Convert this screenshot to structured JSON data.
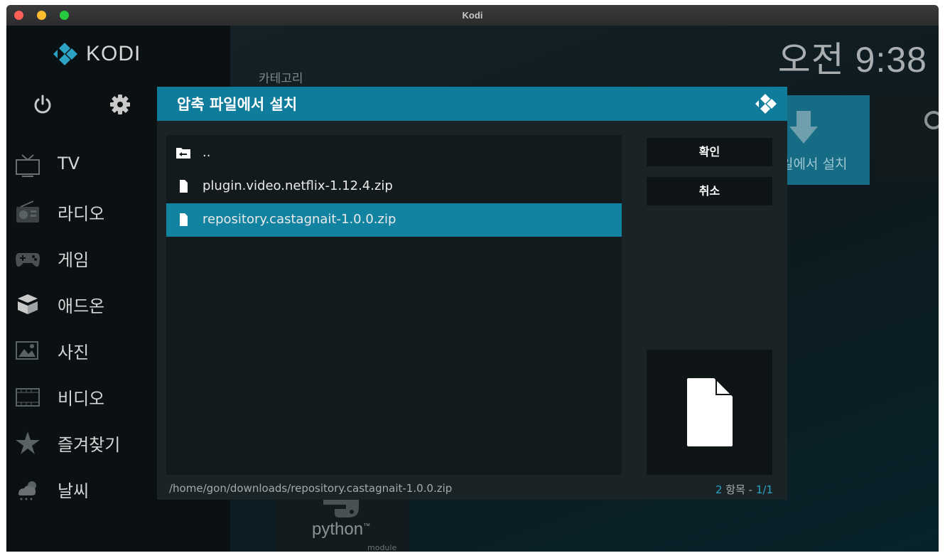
{
  "window": {
    "title": "Kodi"
  },
  "header": {
    "clock": "오전 9:38",
    "logo_text": "KODI"
  },
  "sidebar": {
    "items": [
      {
        "label": "TV",
        "icon": "tv-icon"
      },
      {
        "label": "라디오",
        "icon": "radio-icon"
      },
      {
        "label": "게임",
        "icon": "gamepad-icon"
      },
      {
        "label": "애드온",
        "icon": "addons-box-icon"
      },
      {
        "label": "사진",
        "icon": "picture-icon"
      },
      {
        "label": "비디오",
        "icon": "film-icon"
      },
      {
        "label": "즐겨찾기",
        "icon": "star-icon"
      },
      {
        "label": "날씨",
        "icon": "weather-icon"
      }
    ]
  },
  "background": {
    "category_label": "카테고리",
    "tile_label": "일에서 설치",
    "python_text": "python",
    "python_sub": "module"
  },
  "dialog": {
    "title": "압축 파일에서 설치",
    "files": [
      {
        "name": "..",
        "type": "parent-folder",
        "selected": false
      },
      {
        "name": "plugin.video.netflix-1.12.4.zip",
        "type": "file",
        "selected": false
      },
      {
        "name": "repository.castagnait-1.0.0.zip",
        "type": "file",
        "selected": true
      }
    ],
    "ok_label": "확인",
    "cancel_label": "취소",
    "path": "/home/gon/downloads/repository.castagnait-1.0.0.zip",
    "count": "2",
    "count_unit": "항목 -",
    "page": "1/1"
  },
  "colors": {
    "accent": "#11829f",
    "header": "#0f7c9b",
    "sidebar_bg": "#0b1012"
  }
}
